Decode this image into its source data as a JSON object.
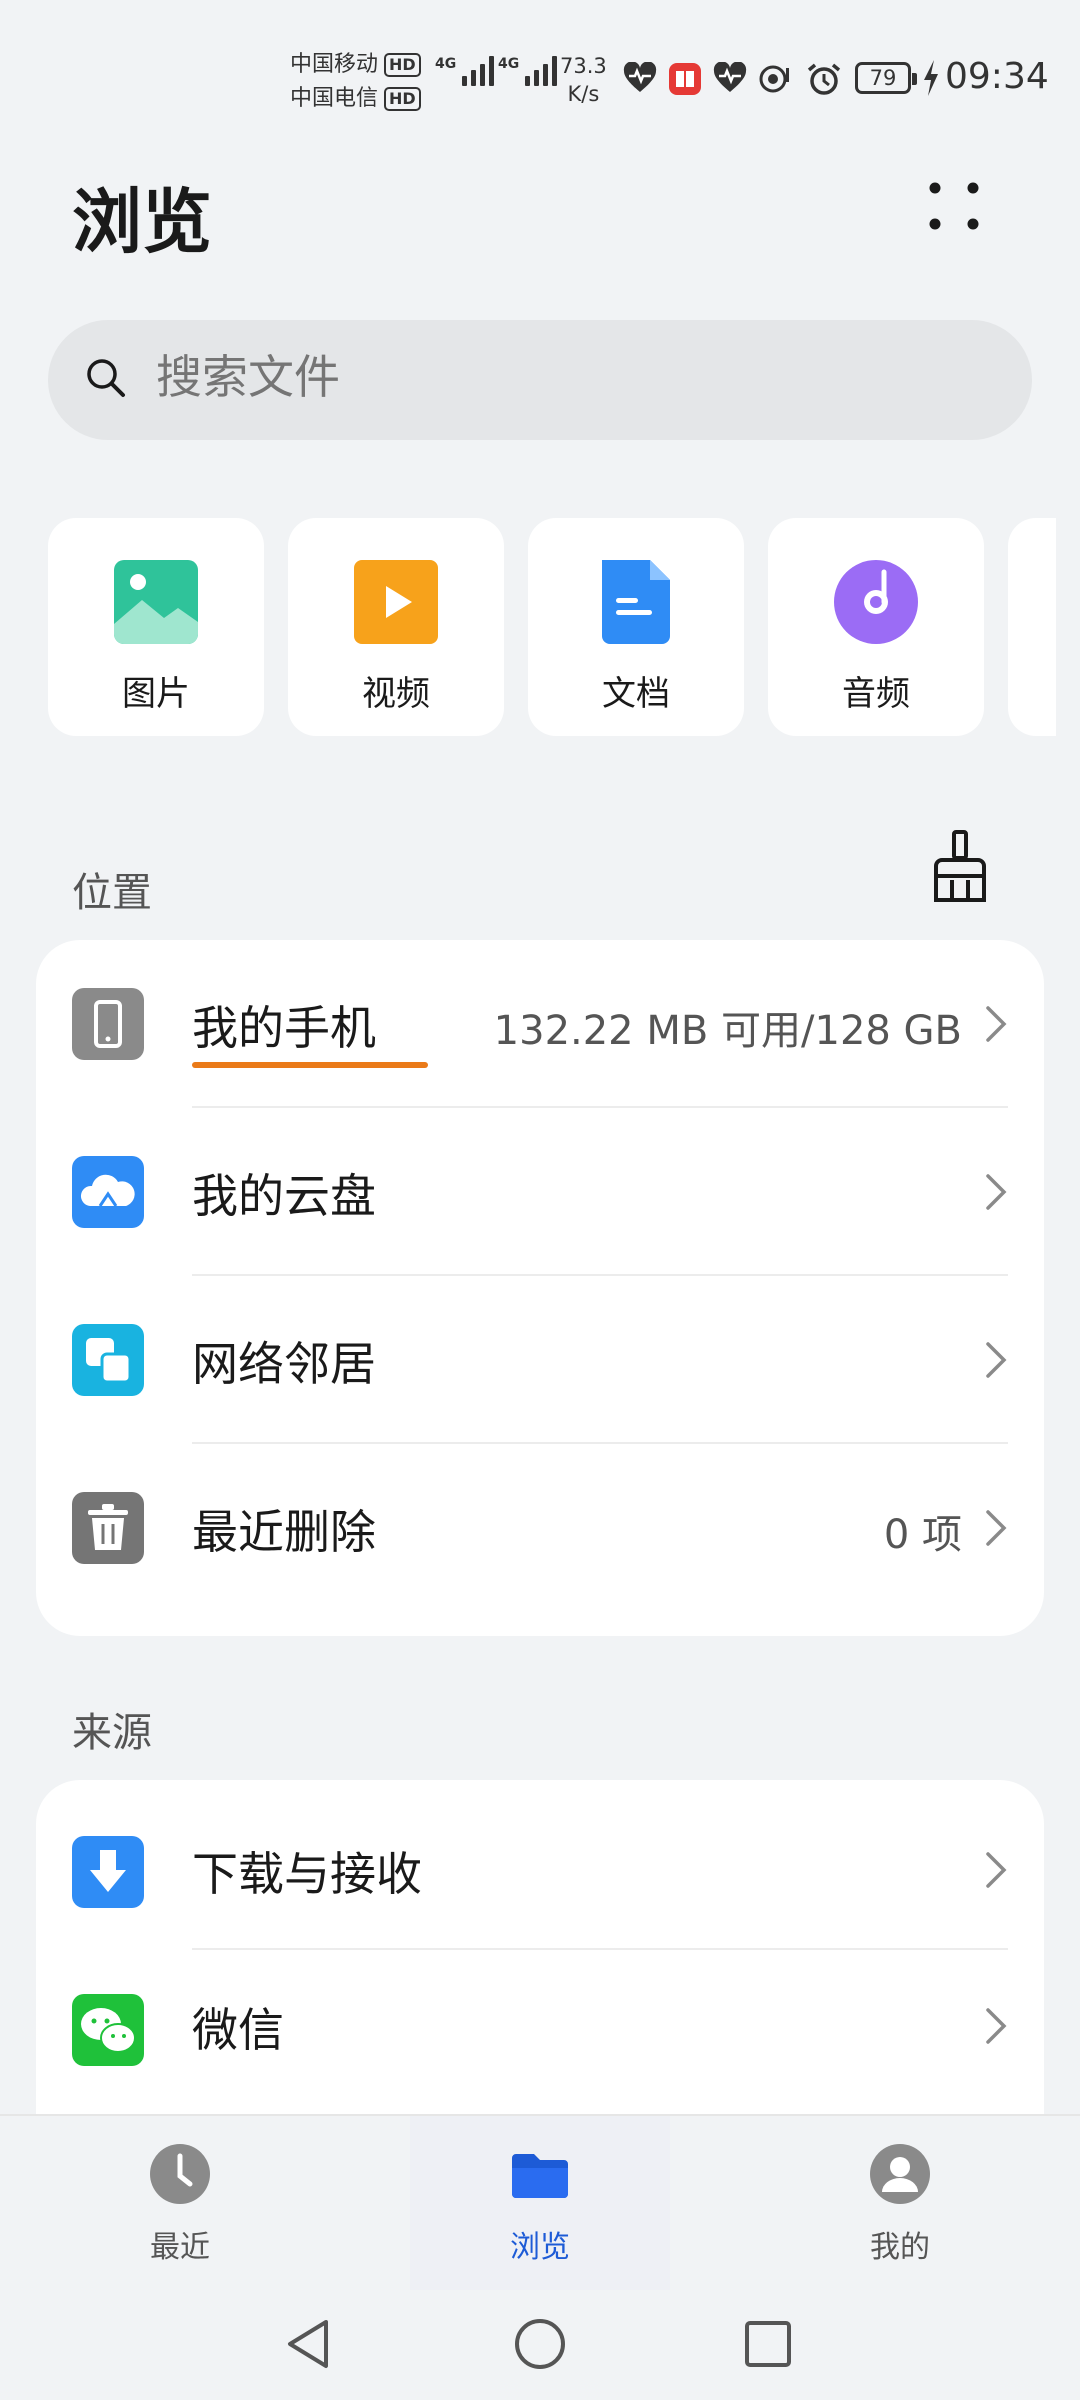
{
  "status_bar": {
    "carrier_1": "中国移动",
    "carrier_2": "中国电信",
    "hd_label": "HD",
    "net_tag": "4G",
    "net_speed_value": "73.3",
    "net_speed_unit": "K/s",
    "battery": "79",
    "time": "09:34"
  },
  "header": {
    "title": "浏览"
  },
  "search": {
    "placeholder": "搜索文件"
  },
  "categories": [
    {
      "label": "图片",
      "icon": "image-icon",
      "color": "#2fc39a"
    },
    {
      "label": "视频",
      "icon": "video-icon",
      "color": "#f7a21b"
    },
    {
      "label": "文档",
      "icon": "document-icon",
      "color": "#2f8cf5"
    },
    {
      "label": "音频",
      "icon": "audio-icon",
      "color": "#9b6cf5"
    }
  ],
  "locations": {
    "title": "位置",
    "items": [
      {
        "label": "我的手机",
        "value": "132.22 MB 可用/128 GB",
        "icon": "phone-icon"
      },
      {
        "label": "我的云盘",
        "value": "",
        "icon": "cloud-icon"
      },
      {
        "label": "网络邻居",
        "value": "",
        "icon": "network-icon"
      },
      {
        "label": "最近删除",
        "value": "0 项",
        "icon": "trash-icon"
      }
    ]
  },
  "sources": {
    "title": "来源",
    "items": [
      {
        "label": "下载与接收",
        "icon": "download-icon"
      },
      {
        "label": "微信",
        "icon": "wechat-icon"
      }
    ]
  },
  "bottom_nav": [
    {
      "label": "最近",
      "icon": "clock-icon",
      "active": false
    },
    {
      "label": "浏览",
      "icon": "folder-icon",
      "active": true
    },
    {
      "label": "我的",
      "icon": "profile-icon",
      "active": false
    }
  ],
  "colors": {
    "accent": "#1d5bd6",
    "underline": "#ea7a18",
    "background": "#f1f3f5"
  }
}
